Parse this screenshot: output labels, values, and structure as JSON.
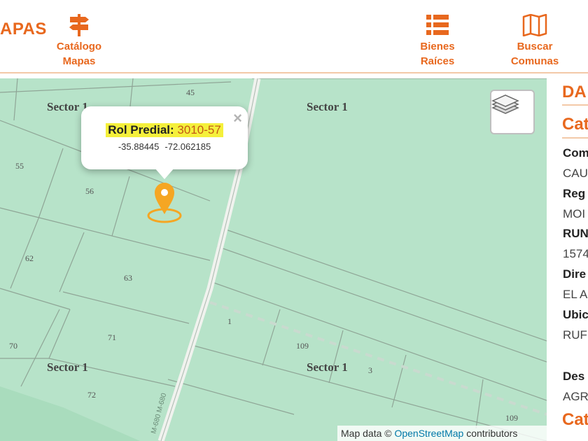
{
  "header": {
    "brand": "APAS",
    "nav": [
      {
        "line1": "Catálogo",
        "line2": "Mapas",
        "icon": "signpost-icon"
      },
      {
        "line1": "Bienes",
        "line2": "Raíces",
        "icon": "list-icon"
      },
      {
        "line1": "Buscar",
        "line2": "Comunas",
        "icon": "map-icon"
      }
    ]
  },
  "map": {
    "sectors": [
      "Sector 1",
      "Sector 1",
      "Sector 1",
      "Sector 1"
    ],
    "parcels": [
      "45",
      "55",
      "56",
      "62",
      "63",
      "1",
      "70",
      "71",
      "109",
      "72",
      "3",
      "109"
    ],
    "road_label": "M-680 M-680",
    "popup": {
      "label": "Rol Predial:",
      "value": "3010-57",
      "lat": "-35.88445",
      "lon": "-72.062185",
      "close": "×"
    },
    "attribution": {
      "prefix": "Map data ©",
      "link": "OpenStreetMap",
      "suffix": "contributors"
    },
    "colors": {
      "land": "#b7e3c9",
      "accent": "#e8681e",
      "marker": "#f5a623",
      "highlight": "#f5f03b"
    }
  },
  "sidebar": {
    "title": "DA",
    "section1": "Cat",
    "fields": [
      {
        "label": "Com",
        "value": "CAU"
      },
      {
        "label": "Reg",
        "value": "MOI"
      },
      {
        "label": "RUN",
        "value": "1574"
      },
      {
        "label": "Dire",
        "value": "EL A"
      },
      {
        "label": "Ubic",
        "value": "RUF"
      },
      {
        "label": "Des",
        "value": "AGR"
      }
    ],
    "section2": "Cat"
  }
}
